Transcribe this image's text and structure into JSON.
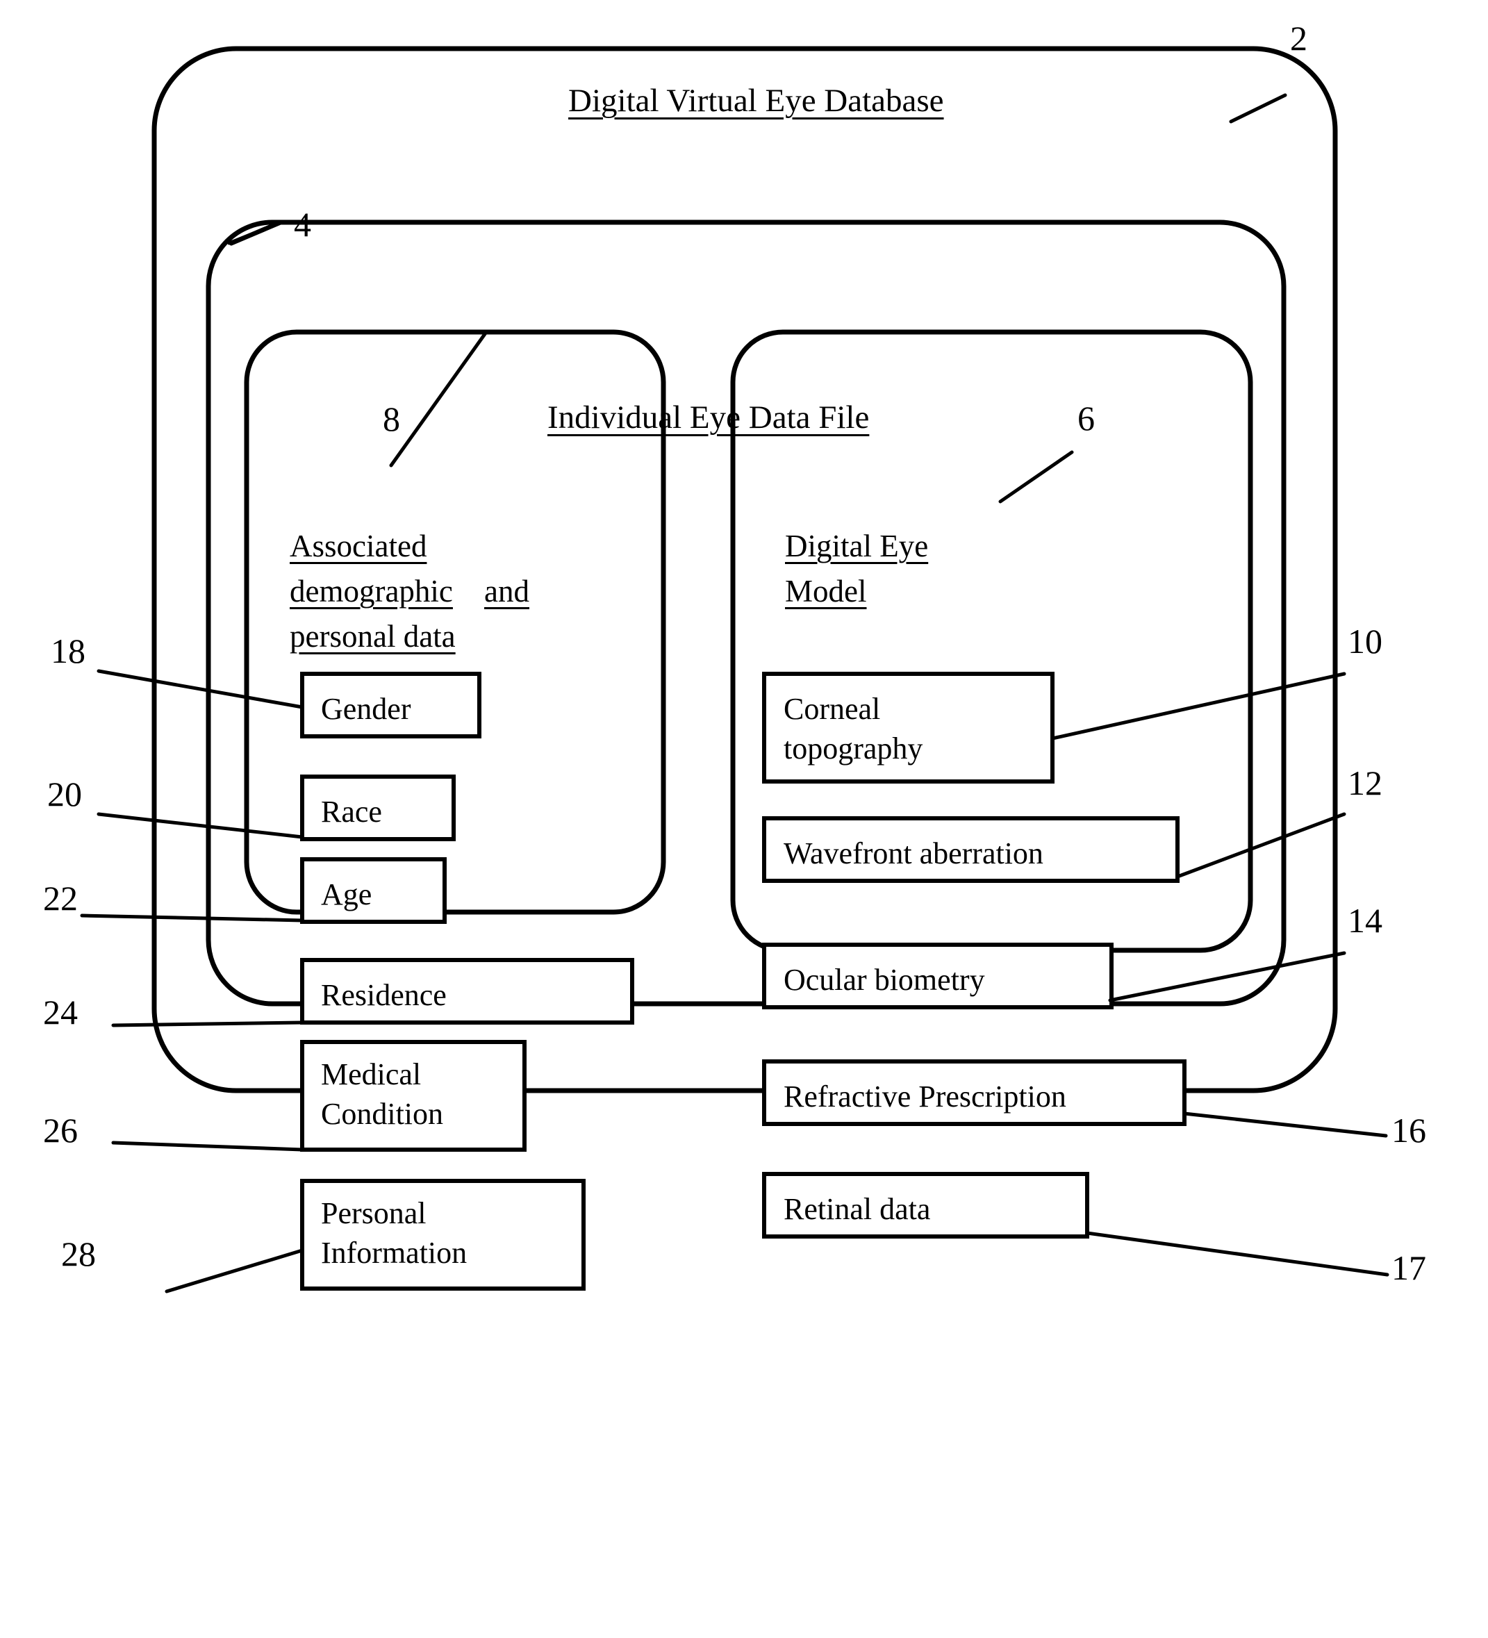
{
  "figure": {
    "outer_container": {
      "title": "Digital Virtual Eye Database",
      "ref": "2"
    },
    "mid_container": {
      "title": "Individual Eye Data File",
      "ref": "4"
    },
    "left_panel": {
      "ref": "8",
      "heading_lines": [
        "Associated",
        "demographic",
        "and",
        "personal data"
      ],
      "items": [
        {
          "ref": "18",
          "label": "Gender"
        },
        {
          "ref": "20",
          "label": "Race"
        },
        {
          "ref": "22",
          "label": "Age"
        },
        {
          "ref": "24",
          "label": "Residence"
        },
        {
          "ref": "26",
          "label_line1": "Medical",
          "label_line2": "Condition"
        },
        {
          "ref": "28",
          "label_line1": "Personal",
          "label_line2": "Information"
        }
      ]
    },
    "right_panel": {
      "ref": "6",
      "heading_lines": [
        "Digital Eye",
        "Model"
      ],
      "items": [
        {
          "ref": "10",
          "label_line1": "Corneal",
          "label_line2": "topography"
        },
        {
          "ref": "12",
          "label": "Wavefront aberration"
        },
        {
          "ref": "14",
          "label": "Ocular biometry"
        },
        {
          "ref": "16",
          "label": "Refractive Prescription"
        },
        {
          "ref": "17",
          "label": "Retinal data"
        }
      ]
    },
    "colors": {
      "ink": "#000000",
      "paper": "#ffffff"
    }
  }
}
